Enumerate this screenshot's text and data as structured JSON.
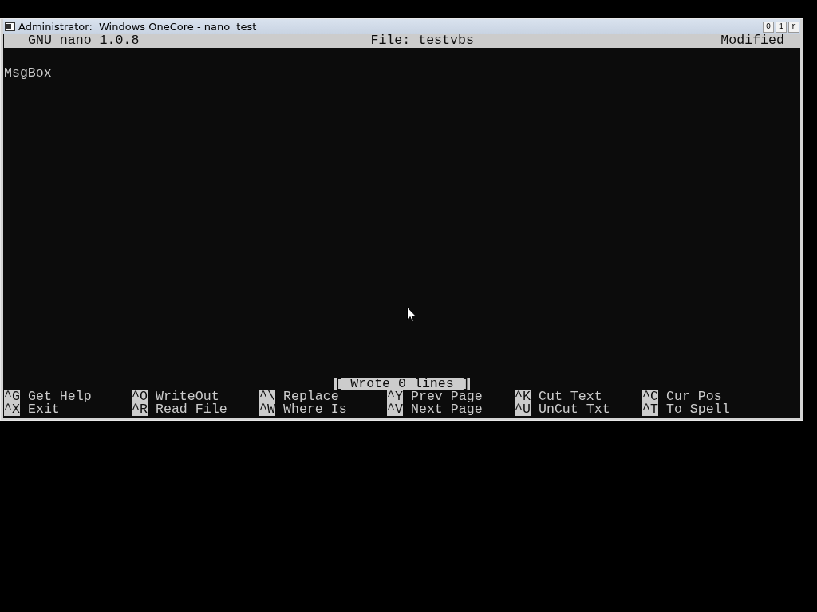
{
  "window": {
    "title": "Administrator:  Windows OneCore - nano  test",
    "controls": [
      "0",
      "1",
      "r"
    ]
  },
  "header": {
    "version": "GNU nano 1.0.8",
    "file": "File: testvbs",
    "state": "Modified"
  },
  "editor": {
    "lines": [
      "MsgBox"
    ]
  },
  "status_message": "[ Wrote 0 lines ]",
  "shortcuts": [
    {
      "key": "^G",
      "label": "Get Help"
    },
    {
      "key": "^O",
      "label": "WriteOut"
    },
    {
      "key": "^\\",
      "label": "Replace"
    },
    {
      "key": "^Y",
      "label": "Prev Page"
    },
    {
      "key": "^K",
      "label": "Cut Text"
    },
    {
      "key": "^C",
      "label": "Cur Pos"
    },
    {
      "key": "^X",
      "label": "Exit"
    },
    {
      "key": "^R",
      "label": "Read File"
    },
    {
      "key": "^W",
      "label": "Where Is"
    },
    {
      "key": "^V",
      "label": "Next Page"
    },
    {
      "key": "^U",
      "label": "UnCut Txt"
    },
    {
      "key": "^T",
      "label": "To Spell"
    }
  ]
}
